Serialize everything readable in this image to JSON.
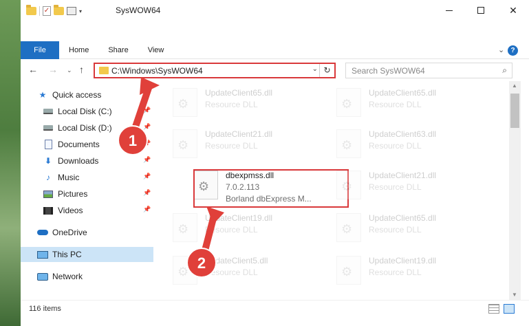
{
  "window": {
    "title": "SysWOW64",
    "qat_check_glyph": "✓",
    "qat_dropdown_glyph": "▾"
  },
  "caption": {
    "close": "✕"
  },
  "ribbon": {
    "tabs": [
      "File",
      "Home",
      "Share",
      "View"
    ],
    "chevron": "⌄",
    "help": "?"
  },
  "nav": {
    "back": "←",
    "forward": "→",
    "recent": "⌄",
    "up": "↑",
    "address": "C:\\Windows\\SysWOW64",
    "address_dropdown": "⌄",
    "refresh": "↻",
    "search_placeholder": "Search SysWOW64",
    "search_glyph": "⌕"
  },
  "sidebar": {
    "items": [
      {
        "label": "Quick access",
        "icon": "star-icon"
      },
      {
        "label": "Local Disk (C:)",
        "icon": "drive-icon"
      },
      {
        "label": "Local Disk (D:)",
        "icon": "drive-icon"
      },
      {
        "label": "Documents",
        "icon": "documents-icon"
      },
      {
        "label": "Downloads",
        "icon": "downloads-icon"
      },
      {
        "label": "Music",
        "icon": "music-icon"
      },
      {
        "label": "Pictures",
        "icon": "pictures-icon"
      },
      {
        "label": "Videos",
        "icon": "videos-icon"
      },
      {
        "label": "OneDrive",
        "icon": "onedrive-icon"
      },
      {
        "label": "This PC",
        "icon": "this-pc-icon"
      },
      {
        "label": "Network",
        "icon": "network-icon"
      }
    ],
    "star_glyph": "★",
    "downloads_glyph": "⬇",
    "music_glyph": "♪",
    "pin_glyph": "📌"
  },
  "files": [
    {
      "name": "UpdateClient65.dll",
      "desc": "Resource DLL"
    },
    {
      "name": "UpdateClient65.dll",
      "desc": "Resource DLL"
    },
    {
      "name": "UpdateClient21.dll",
      "desc": "Resource DLL"
    },
    {
      "name": "UpdateClient63.dll",
      "desc": "Resource DLL"
    },
    {
      "name": "dbexpmss.dll",
      "desc": "7.0.2.113",
      "desc2": "Borland dbExpress M..."
    },
    {
      "name": "UpdateClient21.dll",
      "desc": "Resource DLL"
    },
    {
      "name": "UpdateClient19.dll",
      "desc": "Resource DLL"
    },
    {
      "name": "UpdateClient65.dll",
      "desc": "Resource DLL"
    },
    {
      "name": "UpdateClient5.dll",
      "desc": "Resource DLL"
    },
    {
      "name": "UpdateClient19.dll",
      "desc": "Resource DLL"
    }
  ],
  "scroll": {
    "up": "▲",
    "down": "▼"
  },
  "status": {
    "count": "116 items"
  },
  "annotations": {
    "step1": "1",
    "step2": "2"
  },
  "colors": {
    "accent": "#1e6fc3",
    "highlight_red": "#d9383a",
    "annotation_red": "#e0403a",
    "selection": "#cce4f7"
  }
}
